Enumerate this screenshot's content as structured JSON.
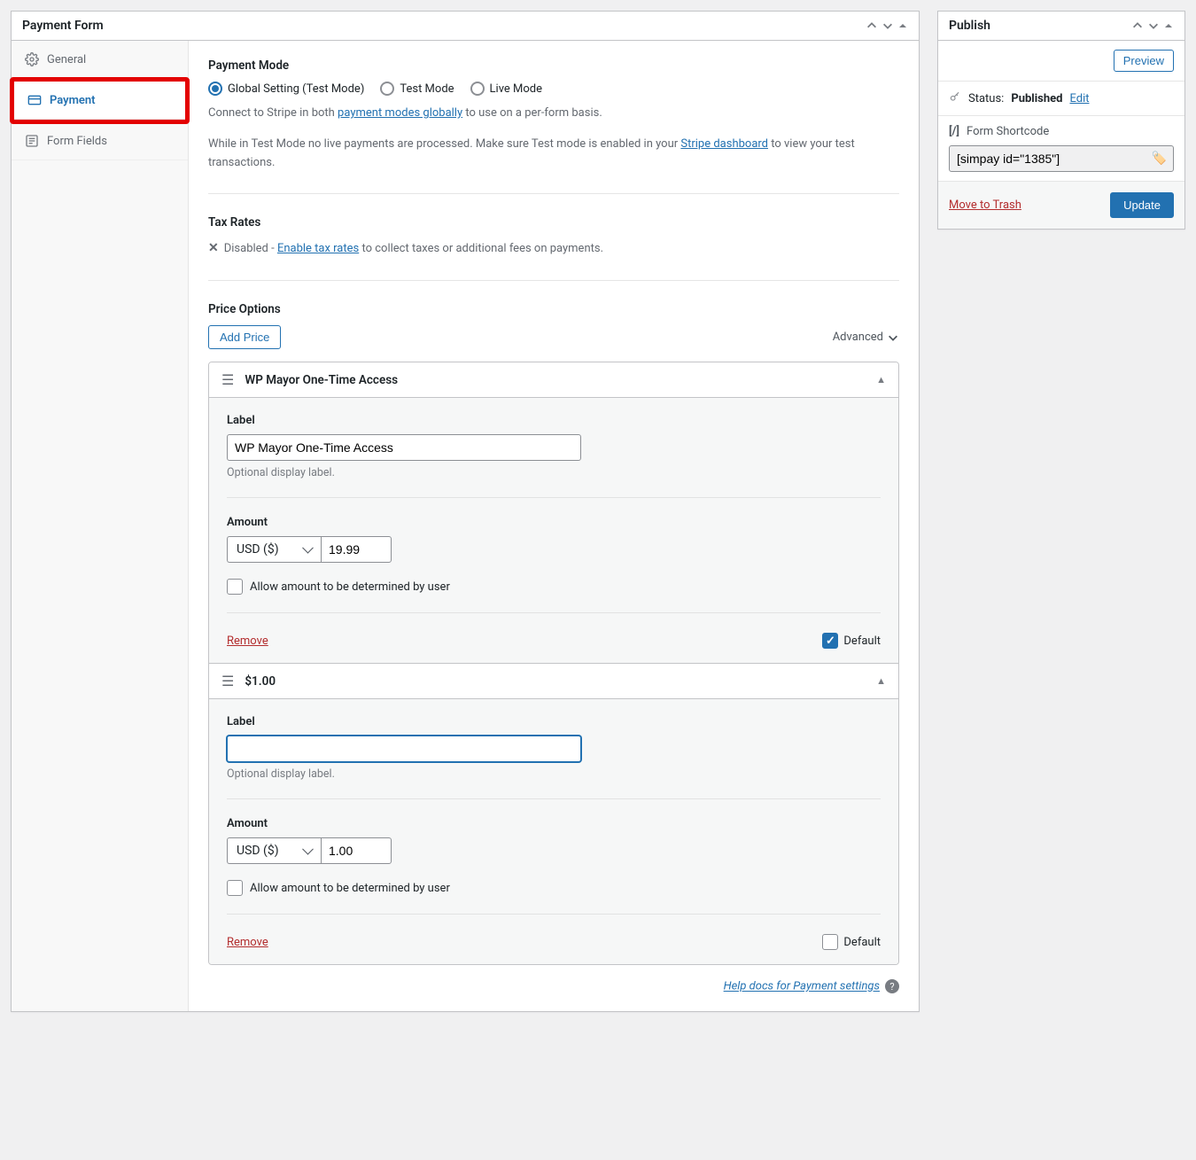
{
  "main": {
    "title": "Payment Form",
    "tabs": {
      "general": "General",
      "payment": "Payment",
      "form_fields": "Form Fields"
    },
    "payment_mode": {
      "heading": "Payment Mode",
      "options": {
        "global": "Global Setting (Test Mode)",
        "test": "Test Mode",
        "live": "Live Mode"
      },
      "help1_a": "Connect to Stripe in both ",
      "help1_link": "payment modes globally",
      "help1_b": " to use on a per-form basis.",
      "help2_a": "While in Test Mode no live payments are processed. Make sure Test mode is enabled in your ",
      "help2_link": "Stripe dashboard",
      "help2_b": " to view your test transactions."
    },
    "tax": {
      "heading": "Tax Rates",
      "disabled": "Disabled - ",
      "link": "Enable tax rates",
      "tail": " to collect taxes or additional fees on payments."
    },
    "prices": {
      "heading": "Price Options",
      "add_btn": "Add Price",
      "advanced": "Advanced",
      "items": [
        {
          "title": "WP Mayor One-Time Access",
          "label_heading": "Label",
          "label_value": "WP Mayor One-Time Access",
          "label_help": "Optional display label.",
          "label_focused": false,
          "amount_heading": "Amount",
          "currency": "USD ($)",
          "amount": "19.99",
          "allow_user_label": "Allow amount to be determined by user",
          "allow_user_checked": false,
          "remove": "Remove",
          "default_label": "Default",
          "default_checked": true
        },
        {
          "title": "$1.00",
          "label_heading": "Label",
          "label_value": "",
          "label_help": "Optional display label.",
          "label_focused": true,
          "amount_heading": "Amount",
          "currency": "USD ($)",
          "amount": "1.00",
          "allow_user_label": "Allow amount to be determined by user",
          "allow_user_checked": false,
          "remove": "Remove",
          "default_label": "Default",
          "default_checked": false
        }
      ]
    },
    "help_docs": "Help docs for Payment settings"
  },
  "publish": {
    "title": "Publish",
    "preview": "Preview",
    "status_label": "Status: ",
    "status_value": "Published",
    "edit": "Edit",
    "shortcode_label": "Form Shortcode",
    "shortcode_value": "[simpay id=\"1385\"]",
    "trash": "Move to Trash",
    "update": "Update"
  }
}
